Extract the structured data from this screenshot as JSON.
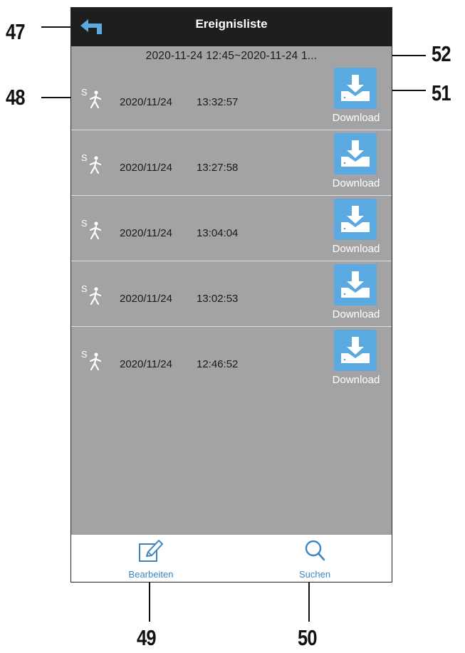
{
  "app": {
    "title": "Ereignisliste",
    "range": "2020-11-24 12:45~2020-11-24 1..."
  },
  "events": [
    {
      "icon": "motion-detection-icon",
      "icon_letter": "S",
      "date": "2020/11/24",
      "time": "13:32:57",
      "download_label": "Download"
    },
    {
      "icon": "motion-detection-icon",
      "icon_letter": "S",
      "date": "2020/11/24",
      "time": "13:27:58",
      "download_label": "Download"
    },
    {
      "icon": "motion-detection-icon",
      "icon_letter": "S",
      "date": "2020/11/24",
      "time": "13:04:04",
      "download_label": "Download"
    },
    {
      "icon": "motion-detection-icon",
      "icon_letter": "S",
      "date": "2020/11/24",
      "time": "13:02:53",
      "download_label": "Download"
    },
    {
      "icon": "motion-detection-icon",
      "icon_letter": "S",
      "date": "2020/11/24",
      "time": "12:46:52",
      "download_label": "Download"
    }
  ],
  "bottom_bar": {
    "edit_label": "Bearbeiten",
    "search_label": "Suchen"
  },
  "callouts": {
    "back": "47",
    "event_icon": "48",
    "edit": "49",
    "search": "50",
    "download": "51",
    "range": "52"
  },
  "colors": {
    "titlebar": "#1e1e1e",
    "list_background": "#a3a3a5",
    "download_button": "#5aa9e0",
    "accent": "#3a86c4"
  }
}
